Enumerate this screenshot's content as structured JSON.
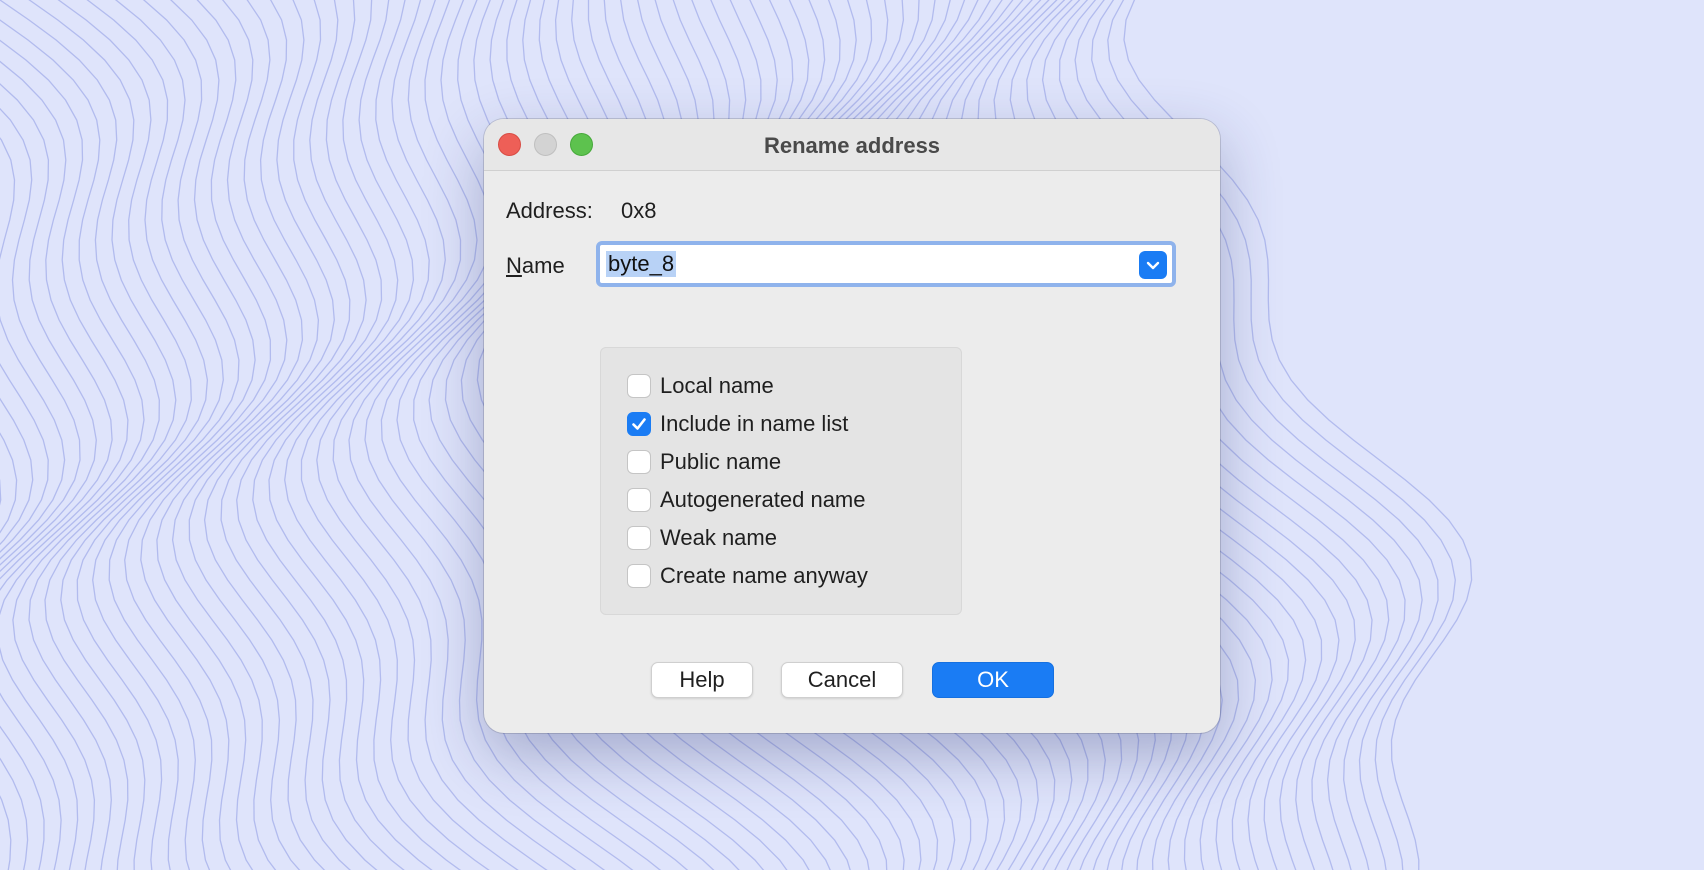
{
  "window": {
    "title": "Rename address",
    "traffic_lights": [
      "close",
      "minimize",
      "zoom"
    ]
  },
  "address": {
    "label": "Address:",
    "value": "0x8"
  },
  "name": {
    "label_underlined": "N",
    "label_rest": "ame",
    "value": "byte_8",
    "dropdown_icon": "chevron-down-icon"
  },
  "options": [
    {
      "label": "Local name",
      "checked": false
    },
    {
      "label": "Include in name list",
      "checked": true
    },
    {
      "label": "Public name",
      "checked": false
    },
    {
      "label": "Autogenerated name",
      "checked": false
    },
    {
      "label": "Weak name",
      "checked": false
    },
    {
      "label": "Create name anyway",
      "checked": false
    }
  ],
  "buttons": {
    "help": "Help",
    "cancel": "Cancel",
    "ok": "OK"
  },
  "colors": {
    "accent": "#1a7cf4",
    "wallpaper": "#dfe4fb",
    "wallpaper_lines": "#a3adea",
    "dialog_bg": "#ececec"
  }
}
